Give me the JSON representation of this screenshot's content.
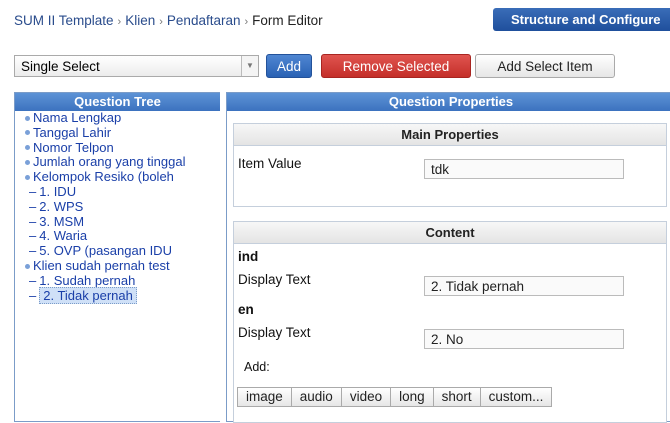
{
  "breadcrumb": [
    "SUM II Template",
    "Klien",
    "Pendaftaran",
    "Form Editor"
  ],
  "structure_button": "Structure and Configure",
  "toolbar": {
    "select_value": "Single Select",
    "add_label": "Add",
    "remove_label": "Remove Selected",
    "add_select_label": "Add Select Item"
  },
  "tree": {
    "title": "Question Tree",
    "items": [
      "Nama Lengkap",
      "Tanggal Lahir",
      "Nomor Telpon",
      "Jumlah orang yang tinggal",
      "Kelompok Resiko (boleh",
      "1. IDU",
      "2. WPS",
      "3. MSM",
      "4. Waria",
      "5. OVP (pasangan IDU",
      "Klien sudah pernah test",
      "1. Sudah pernah",
      "2. Tidak pernah"
    ]
  },
  "props": {
    "title": "Question Properties",
    "main_title": "Main Properties",
    "item_value_label": "Item Value",
    "item_value": "tdk",
    "content_title": "Content",
    "lang1": "ind",
    "display_label1": "Display Text",
    "display_value1": "2. Tidak pernah",
    "lang2": "en",
    "display_label2": "Display Text",
    "display_value2": "2. No",
    "add_label": "Add:",
    "media_buttons": [
      "image",
      "audio",
      "video",
      "long",
      "short",
      "custom..."
    ]
  },
  "colors": {
    "accent_blue": "#3c72bf",
    "remove_red": "#c42f2a",
    "link_blue": "#1a3fa8"
  }
}
